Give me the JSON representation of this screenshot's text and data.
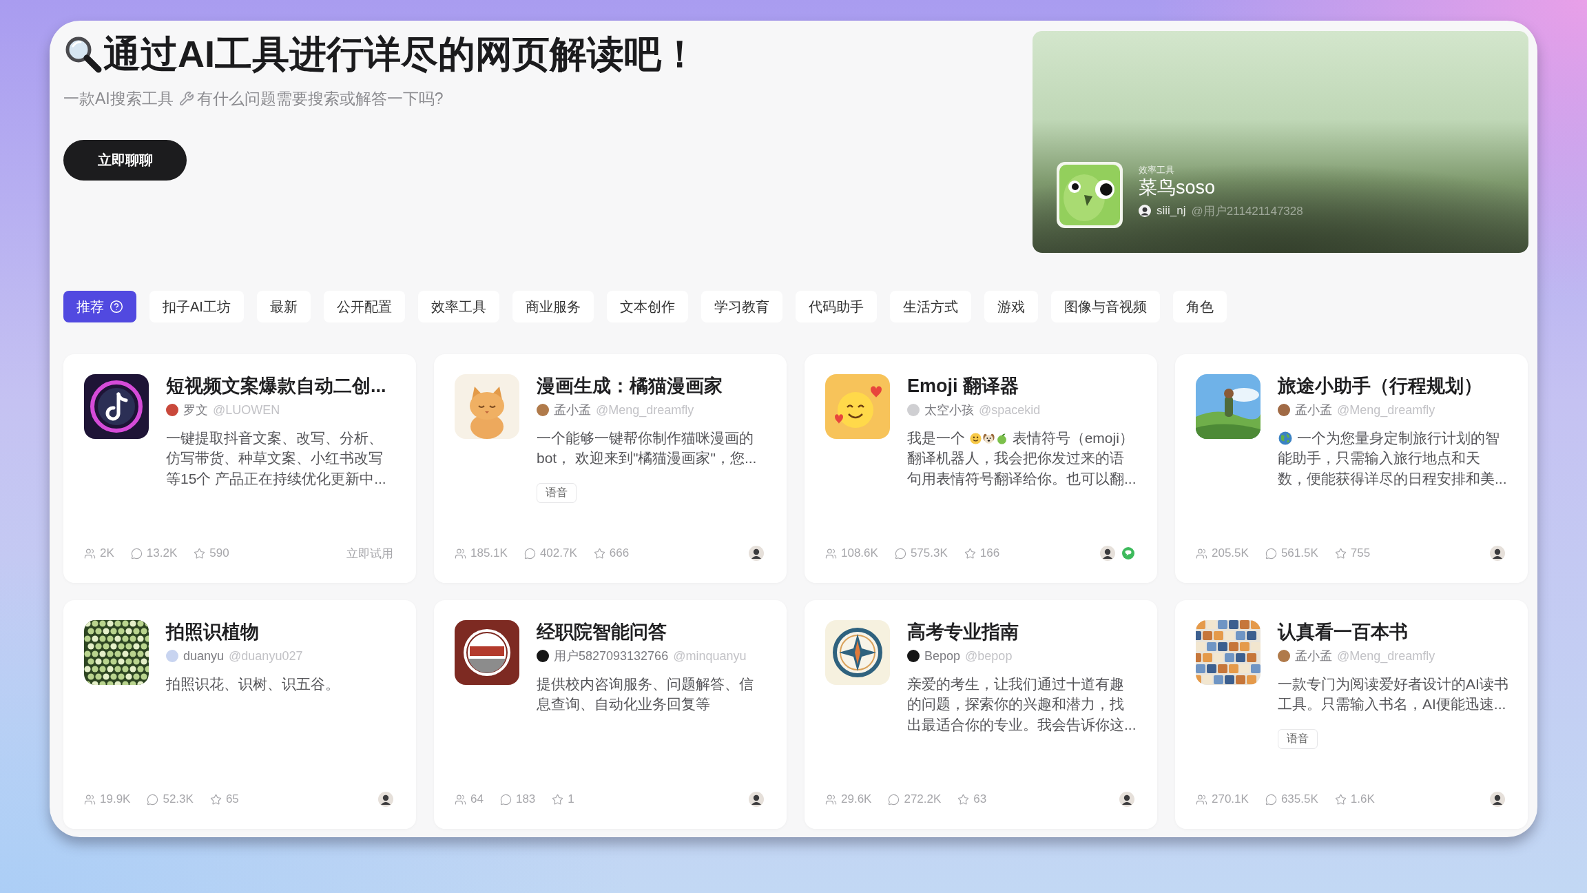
{
  "header": {
    "title": "通过AI工具进行详尽的网页解读吧！",
    "subtitle": {
      "before": "一款AI搜索工具",
      "after": "有什么问题需要搜索或解答一下吗?"
    },
    "button": "立即聊聊"
  },
  "featured": {
    "category": "效率工具",
    "name": "菜鸟soso",
    "author": "siii_nj",
    "handle": "@用户211421147328"
  },
  "tabs": [
    {
      "label": "推荐",
      "selected": true,
      "help": true
    },
    {
      "label": "扣子AI工坊",
      "selected": false,
      "help": false
    },
    {
      "label": "最新",
      "selected": false,
      "help": false
    },
    {
      "label": "公开配置",
      "selected": false,
      "help": false
    },
    {
      "label": "效率工具",
      "selected": false,
      "help": false
    },
    {
      "label": "商业服务",
      "selected": false,
      "help": false
    },
    {
      "label": "文本创作",
      "selected": false,
      "help": false
    },
    {
      "label": "学习教育",
      "selected": false,
      "help": false
    },
    {
      "label": "代码助手",
      "selected": false,
      "help": false
    },
    {
      "label": "生活方式",
      "selected": false,
      "help": false
    },
    {
      "label": "游戏",
      "selected": false,
      "help": false
    },
    {
      "label": "图像与音视频",
      "selected": false,
      "help": false
    },
    {
      "label": "角色",
      "selected": false,
      "help": false
    }
  ],
  "cards": [
    {
      "thumb": {
        "kind": "tiktok"
      },
      "title": "短视频文案爆款自动二创...",
      "author": "罗文",
      "handle": "@LUOWEN",
      "description": "一键提取抖音文案、改写、分析、仿写带货、种草文案、小红书改写等15个 产品正在持续优化更新中...",
      "stats": {
        "users": "2K",
        "chats": "13.2K",
        "favorites": "590"
      },
      "extras": [
        {
          "kind": "link",
          "label": "立即试用"
        }
      ]
    },
    {
      "thumb": {
        "kind": "cat"
      },
      "title": "漫画生成：橘猫漫画家",
      "author": "孟小孟",
      "handle": "@Meng_dreamfly",
      "description": "一个能够一键帮你制作猫咪漫画的bot， 欢迎来到\"橘猫漫画家\"，您...",
      "tag": "语音",
      "stats": {
        "users": "185.1K",
        "chats": "402.7K",
        "favorites": "666"
      },
      "extras": [
        {
          "kind": "avatar"
        }
      ]
    },
    {
      "thumb": {
        "kind": "smiley"
      },
      "title": "Emoji 翻译器",
      "author": "太空小孩",
      "handle": "@spacekid",
      "description": [
        {
          "kind": "text",
          "text": "我是一个 "
        },
        {
          "kind": "smiley"
        },
        {
          "kind": "dog"
        },
        {
          "kind": "apple"
        },
        {
          "kind": "text",
          "text": " 表情符号（emoji）翻译机器人，我会把你发过来的语句用表情符号翻译给你。也可以翻..."
        }
      ],
      "stats": {
        "users": "108.6K",
        "chats": "575.3K",
        "favorites": "166"
      },
      "extras": [
        {
          "kind": "avatar"
        },
        {
          "kind": "chat"
        }
      ]
    },
    {
      "thumb": {
        "kind": "hiker"
      },
      "title": "旅途小助手（行程规划）",
      "author": "孟小孟",
      "handle": "@Meng_dreamfly",
      "description": [
        {
          "kind": "globe"
        },
        {
          "kind": "text",
          "text": " 一个为您量身定制旅行计划的智能助手，只需输入旅行地点和天数，便能获得详尽的日程安排和美..."
        }
      ],
      "stats": {
        "users": "205.5K",
        "chats": "561.5K",
        "favorites": "755"
      },
      "extras": [
        {
          "kind": "avatar"
        }
      ]
    },
    {
      "thumb": {
        "kind": "leaves"
      },
      "title": "拍照识植物",
      "author": "duanyu",
      "handle": "@duanyu027",
      "description": "拍照识花、识树、识五谷。",
      "stats": {
        "users": "19.9K",
        "chats": "52.3K",
        "favorites": "65"
      },
      "extras": [
        {
          "kind": "avatar"
        }
      ]
    },
    {
      "thumb": {
        "kind": "emblem"
      },
      "title": "经职院智能问答",
      "author": "用户5827093132766",
      "handle": "@minquanyu",
      "description": "提供校内咨询服务、问题解答、信息查询、自动化业务回复等",
      "stats": {
        "users": "64",
        "chats": "183",
        "favorites": "1"
      },
      "extras": [
        {
          "kind": "avatar"
        }
      ]
    },
    {
      "thumb": {
        "kind": "compass"
      },
      "title": "高考专业指南",
      "author": "Bepop",
      "handle": "@bepop",
      "description": "亲爱的考生，让我们通过十道有趣的问题，探索你的兴趣和潜力，找出最适合你的专业。我会告诉你这...",
      "stats": {
        "users": "29.6K",
        "chats": "272.2K",
        "favorites": "63"
      },
      "extras": [
        {
          "kind": "avatar"
        }
      ]
    },
    {
      "thumb": {
        "kind": "books"
      },
      "title": "认真看一百本书",
      "author": "孟小孟",
      "handle": "@Meng_dreamfly",
      "description": "一款专门为阅读爱好者设计的AI读书工具。只需输入书名，AI便能迅速...",
      "tag": "语音",
      "stats": {
        "users": "270.1K",
        "chats": "635.5K",
        "favorites": "1.6K"
      },
      "extras": [
        {
          "kind": "avatar"
        }
      ]
    }
  ]
}
